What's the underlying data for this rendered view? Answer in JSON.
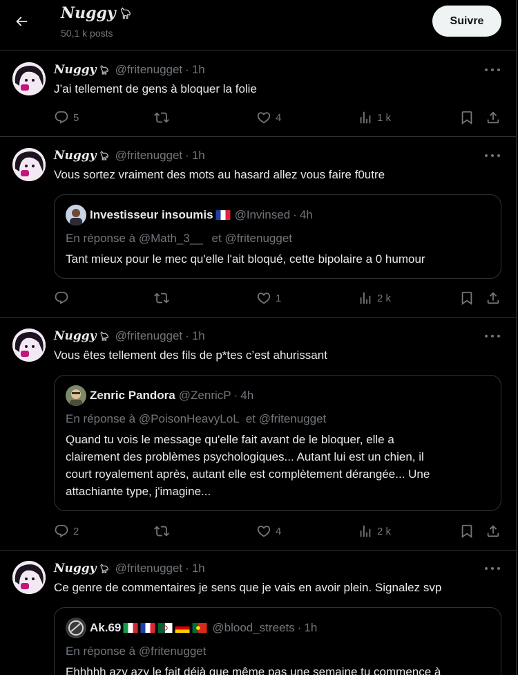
{
  "header": {
    "back_label": "Back",
    "title": "Nuggy",
    "posts_count": "50,1 k posts",
    "follow_label": "Suivre"
  },
  "posts": [
    {
      "author": "Nuggy",
      "handle": "@fritenugget",
      "time": "1h",
      "text": "J’ai tellement de gens à bloquer la folie",
      "replies": "5",
      "reposts": "",
      "likes": "4",
      "views": "1 k"
    },
    {
      "author": "Nuggy",
      "handle": "@fritenugget",
      "time": "1h",
      "text": "Vous sortez vraiment des mots au hasard allez vous faire f0utre",
      "replies": "",
      "reposts": "",
      "likes": "1",
      "views": "2 k",
      "quote": {
        "author": "Investisseur insoumis",
        "handle": "@Invinsed",
        "time": "4h",
        "reply_prefix": "En réponse à",
        "reply_to_1": "@Math_3__",
        "reply_and": "et",
        "reply_to_2": "@fritenugget",
        "text": "Tant mieux pour le mec qu'elle l'ait bloqué, cette bipolaire a 0 humour"
      }
    },
    {
      "author": "Nuggy",
      "handle": "@fritenugget",
      "time": "1h",
      "text": "Vous êtes tellement des fils de p*tes c’est ahurissant",
      "replies": "2",
      "reposts": "",
      "likes": "4",
      "views": "2 k",
      "quote": {
        "author": "Zenric Pandora",
        "handle": "@ZenricP",
        "time": "4h",
        "reply_prefix": "En réponse à",
        "reply_to_1": "@PoisonHeavyLoL",
        "reply_and": "et",
        "reply_to_2": "@fritenugget",
        "text_lines": [
          "Quand tu vois le message qu'elle fait avant de le bloquer, elle a",
          "clairement des problèmes psychologiques... Autant lui est un chien, il",
          "court royalement après, autant elle est complètement dérangée... Une",
          "attachiante type, j'imagine..."
        ]
      }
    },
    {
      "author": "Nuggy",
      "handle": "@fritenugget",
      "time": "1h",
      "text": "Ce genre de commentaires je sens que je vais en avoir plein. Signalez svp",
      "quote": {
        "author": "Ak.69",
        "handle": "@blood_streets",
        "time": "1h",
        "reply_prefix": "En réponse à",
        "reply_to_1": "@fritenugget",
        "text": "Ehhhhh azy azy le fait déjà que même pas une semaine tu commence à"
      }
    }
  ],
  "icons": {
    "back": "arrow-left-icon",
    "reply": "speech-bubble-icon",
    "repost": "repost-arrows-icon",
    "like": "heart-icon",
    "views": "bar-chart-icon",
    "bookmark": "bookmark-icon",
    "share": "share-icon",
    "more": "ellipsis-icon"
  },
  "colors": {
    "background": "#000000",
    "text": "#e7e9ea",
    "muted": "#71767b",
    "border": "#2f3336",
    "follow_bg": "#eff3f4"
  }
}
